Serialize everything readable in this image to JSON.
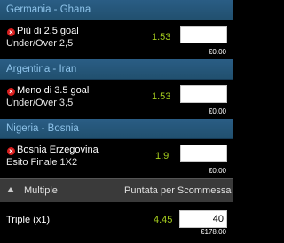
{
  "bets": [
    {
      "match": "Germania - Ghana",
      "selection": "Più di 2.5 goal",
      "market": "Under/Over 2,5",
      "odds": "1.53",
      "stake": "",
      "payout": "€0.00"
    },
    {
      "match": "Argentina - Iran",
      "selection": "Meno di 3.5 goal",
      "market": "Under/Over 3,5",
      "odds": "1.53",
      "stake": "",
      "payout": "€0.00"
    },
    {
      "match": "Nigeria - Bosnia",
      "selection": "Bosnia Erzegovina",
      "market": "Esito Finale 1X2",
      "odds": "1.9",
      "stake": "",
      "payout": "€0.00"
    }
  ],
  "multiple": {
    "label": "Multiple",
    "stake_header": "Puntata per Scommessa",
    "row": {
      "name": "Triple (x1)",
      "odds": "4.45",
      "stake": "40",
      "payout": "€178.00"
    }
  },
  "colors": {
    "header_bg": "#2a5d85",
    "header_text": "#8ec3ea",
    "odds": "#a5cd1e",
    "remove": "#d81e1e"
  }
}
